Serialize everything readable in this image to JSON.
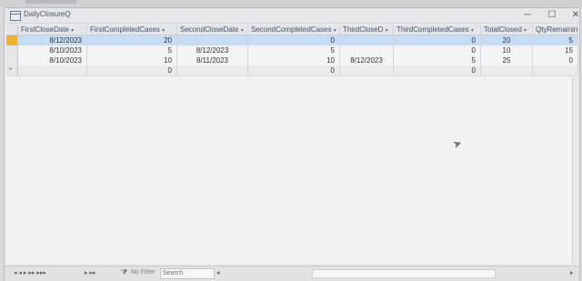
{
  "window": {
    "title": "DailyClosureQ",
    "controls": {
      "minimize": "─",
      "maximize": "☐",
      "close": "✕"
    }
  },
  "table": {
    "columns": [
      "FirstCloseDate",
      "FirstCompletedCases",
      "SecondCloseDate",
      "SecondCompletedCases",
      "ThirdCloseD",
      "ThirdCompletedCases",
      "TotalClosed",
      "QtyRemainin"
    ],
    "sort_arrow": "▾",
    "rows": [
      [
        "8/12/2023",
        "20",
        "",
        "0",
        "",
        "0",
        "20",
        "5"
      ],
      [
        "8/10/2023",
        "5",
        "8/12/2023",
        "5",
        "",
        "0",
        "10",
        "15"
      ],
      [
        "8/10/2023",
        "10",
        "8/11/2023",
        "10",
        "8/12/2023",
        "5",
        "25",
        "0"
      ]
    ],
    "new_row": [
      "",
      "0",
      "",
      "0",
      "",
      "0",
      "",
      ""
    ],
    "new_row_marker": "*"
  },
  "statusbar": {
    "record_nav": "◂ ◂ ▸ ▸▸ ▸▸▸",
    "filter_label": "No Filter",
    "search_placeholder": "Search"
  },
  "icons": {
    "app": "table-icon",
    "cursor": "mouse-pointer-icon",
    "filter": "filter-icon"
  }
}
